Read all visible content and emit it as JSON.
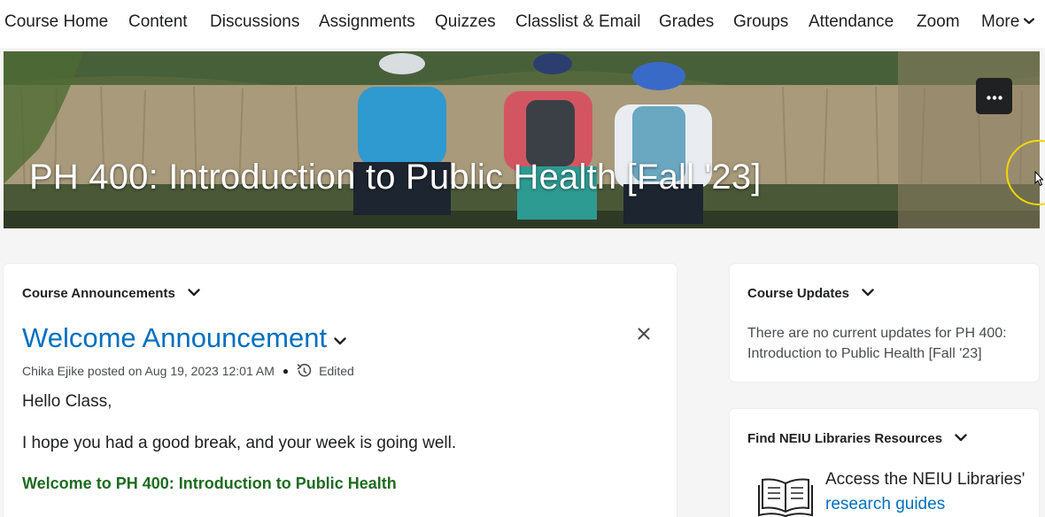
{
  "nav": {
    "items": [
      "Course Home",
      "Content",
      "Discussions",
      "Assignments",
      "Quizzes",
      "Classlist & Email",
      "Grades",
      "Groups",
      "Attendance",
      "Zoom"
    ],
    "more_label": "More"
  },
  "banner": {
    "title": "PH 400: Introduction to Public Health [Fall '23]",
    "menu_icon": "ellipsis-icon"
  },
  "announcements": {
    "header": "Course Announcements",
    "title": "Welcome Announcement",
    "author_line": "Chika Ejike posted on Aug 19, 2023 12:01 AM",
    "edited_label": "Edited",
    "paragraphs": [
      "Hello Class,",
      "I hope you had a good break, and your week is going well."
    ],
    "highlight": "Welcome to PH 400: Introduction to Public Health"
  },
  "updates": {
    "header": "Course Updates",
    "message": "There are no current updates for PH 400: Introduction to Public Health [Fall '23]"
  },
  "library": {
    "header": "Find NEIU Libraries Resources",
    "text": "Access the NEIU Libraries'",
    "link": "research guides"
  },
  "colors": {
    "link": "#006fbf",
    "highlight_green": "#1e6b20",
    "cursor_ring": "#f2d600"
  }
}
